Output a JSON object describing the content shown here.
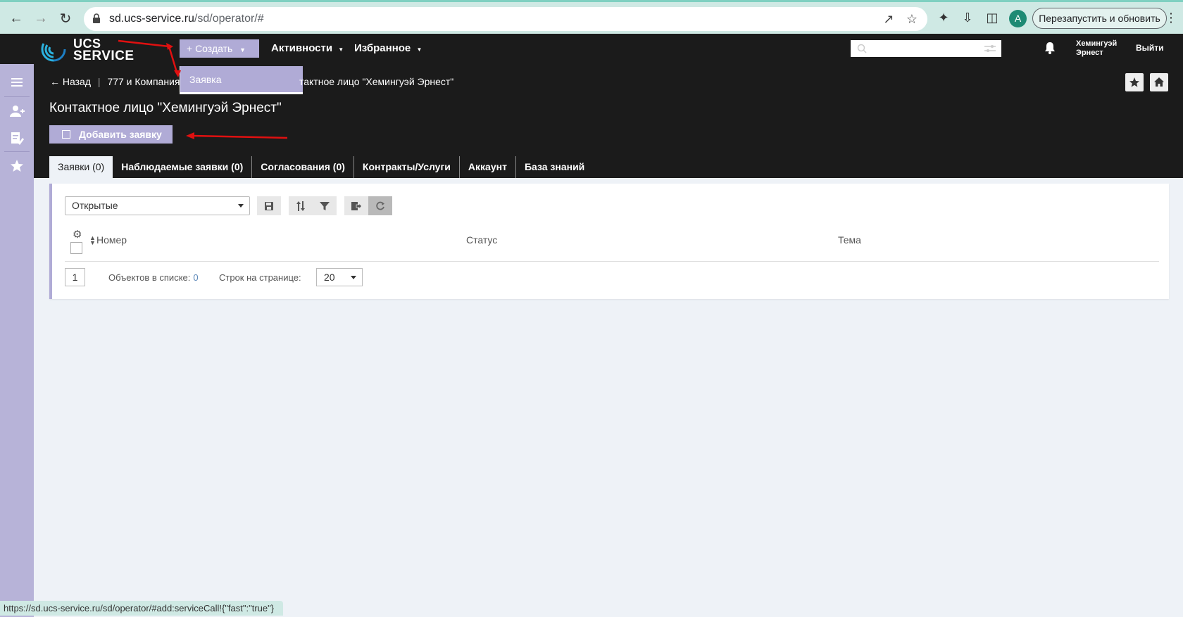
{
  "browser": {
    "url_host": "sd.ucs-service.ru",
    "url_path": "/sd/operator/#",
    "restart_label": "Перезапустить и обновить",
    "profile_initial": "A",
    "status_url": "https://sd.ucs-service.ru/sd/operator/#add:serviceCall!{\"fast\":\"true\"}"
  },
  "header": {
    "logo_line1": "UCS",
    "logo_line2": "SERVICE",
    "create_label": "+ Создать",
    "create_menu_item": "Заявка",
    "menu_activities": "Активности",
    "menu_favorites": "Избранное",
    "user_name_line1": "Хемингуэй",
    "user_name_line2": "Эрнест",
    "logout_label": "Выйти"
  },
  "breadcrumb": {
    "back": "← Назад",
    "company": "777 и Компания",
    "current": "тактное лицо \"Хемингуэй Эрнест\""
  },
  "page": {
    "title": "Контактное лицо \"Хемингуэй Эрнест\"",
    "add_button": "Добавить заявку"
  },
  "tabs": [
    {
      "label": "Заявки (0)"
    },
    {
      "label": "Наблюдаемые заявки (0)"
    },
    {
      "label": "Согласования (0)"
    },
    {
      "label": "Контракты/Услуги"
    },
    {
      "label": "Аккаунт"
    },
    {
      "label": "База знаний"
    }
  ],
  "list": {
    "filter_value": "Открытые",
    "columns": [
      "Номер",
      "Статус",
      "Тема"
    ],
    "page_number": "1",
    "count_label": "Объектов в списке:",
    "count_value": "0",
    "rows_label": "Строк на странице:",
    "rows_value": "20"
  },
  "colors": {
    "accent": "#b0abd6",
    "header_bg": "#1b1b1b",
    "sidebar": "#b7b3d8",
    "annotation_arrow": "#e01010"
  }
}
